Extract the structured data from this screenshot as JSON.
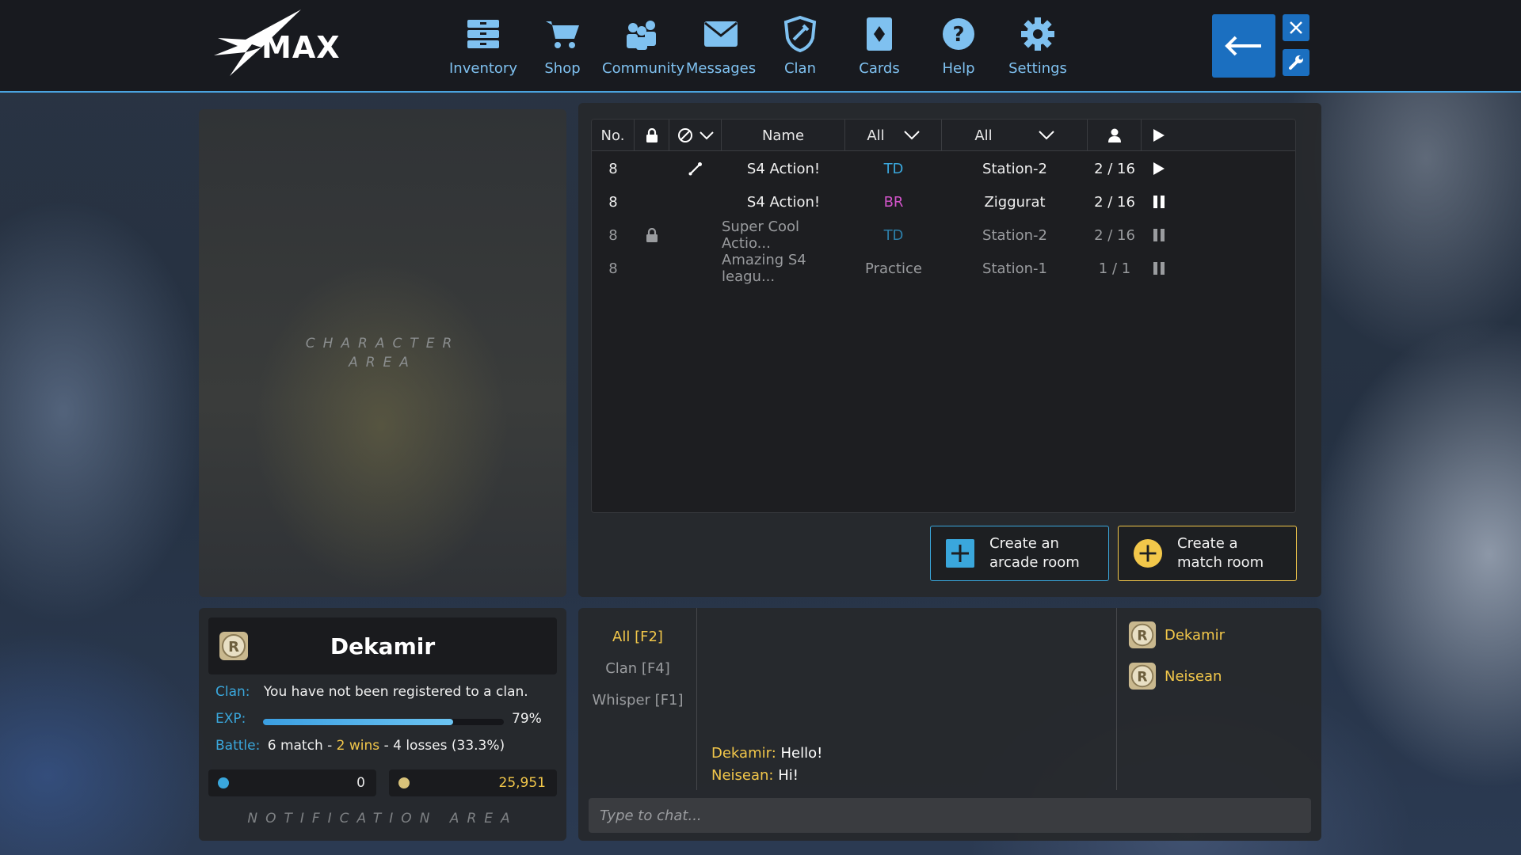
{
  "app": {
    "logo_text": "MAX"
  },
  "nav": [
    {
      "label": "Inventory",
      "icon": "inventory-icon"
    },
    {
      "label": "Shop",
      "icon": "cart-icon"
    },
    {
      "label": "Community",
      "icon": "community-icon"
    },
    {
      "label": "Messages",
      "icon": "envelope-icon"
    },
    {
      "label": "Clan",
      "icon": "shield-icon"
    },
    {
      "label": "Cards",
      "icon": "card-icon"
    },
    {
      "label": "Help",
      "icon": "question-icon"
    },
    {
      "label": "Settings",
      "icon": "gear-icon"
    }
  ],
  "character_area": {
    "line1": "CHARACTER",
    "line2": "AREA"
  },
  "room_table": {
    "headers": {
      "no": "No.",
      "name": "Name",
      "mode_filter": "All",
      "map_filter": "All"
    },
    "rows": [
      {
        "no": "8",
        "locked": false,
        "banned_icon": true,
        "name": "S4 Action!",
        "mode": "TD",
        "map": "Station-2",
        "players": "2 / 16",
        "status": "playing",
        "dim": false
      },
      {
        "no": "8",
        "locked": false,
        "banned_icon": false,
        "name": "S4 Action!",
        "mode": "BR",
        "map": "Ziggurat",
        "players": "2 / 16",
        "status": "waiting",
        "dim": false
      },
      {
        "no": "8",
        "locked": true,
        "banned_icon": false,
        "name": "Super Cool Actio...",
        "mode": "TD",
        "map": "Station-2",
        "players": "2 / 16",
        "status": "waiting",
        "dim": true
      },
      {
        "no": "8",
        "locked": false,
        "banned_icon": false,
        "name": "Amazing S4 leagu...",
        "mode": "Practice",
        "map": "Station-1",
        "players": "1 / 1",
        "status": "waiting",
        "dim": true
      }
    ]
  },
  "create_buttons": {
    "arcade": {
      "line1": "Create an",
      "line2": "arcade room"
    },
    "match": {
      "line1": "Create a",
      "line2": "match room"
    }
  },
  "profile": {
    "name": "Dekamir",
    "clan_label": "Clan:",
    "clan_value": "You have not been registered to a clan.",
    "exp_label": "EXP:",
    "exp_value": "79%",
    "exp_fraction": 0.79,
    "battle_label": "Battle:",
    "battle_matches": "6 match -",
    "battle_wins": "2 wins",
    "battle_losses": "- 4 losses (33.3%)",
    "currency_pen": "0",
    "currency_coin": "25,951",
    "notification": "NOTIFICATION AREA"
  },
  "chat": {
    "tabs": [
      "All [F2]",
      "Clan [F4]",
      "Whisper [F1]"
    ],
    "active_tab": 0,
    "messages": [
      {
        "user": "Dekamir:",
        "text": "Hello!"
      },
      {
        "user": "Neisean:",
        "text": "Hi!"
      }
    ],
    "users": [
      "Dekamir",
      "Neisean"
    ],
    "placeholder": "Type to chat..."
  },
  "colors": {
    "accent_blue": "#3aa7dc",
    "button_blue": "#1b6fc0",
    "gold": "#f2c74a",
    "magenta": "#d154c9"
  }
}
